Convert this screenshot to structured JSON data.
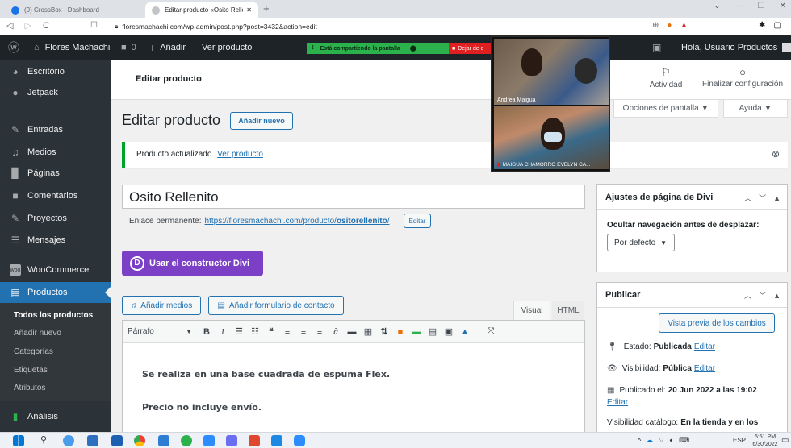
{
  "browser": {
    "tabs": [
      {
        "title": "(9) CrossBox - Dashboard",
        "active": false
      },
      {
        "title": "Editar producto «Osito Rellenito»",
        "active": true
      }
    ],
    "new_tab": "+",
    "url": "floresmachachi.com/wp-admin/post.php?post=3432&action=edit"
  },
  "adminbar": {
    "site": "Flores Machachi",
    "comments_count": "0",
    "add_new": "Añadir",
    "view_product": "Ver producto",
    "greeting": "Hola, Usuario Productos"
  },
  "screen_share": {
    "sharing_label": "Está compartiendo la pantalla",
    "stop_label": "Dejar de c",
    "participant_1": "Andrea Maigua",
    "participant_2": "MAIGUA CHAMORRO EVELYN CA..."
  },
  "sidebar": {
    "items": [
      {
        "label": "Escritorio",
        "icon": "dashboard-icon"
      },
      {
        "label": "Jetpack",
        "icon": "jetpack-icon"
      },
      {
        "label": "Entradas",
        "icon": "pin-icon"
      },
      {
        "label": "Medios",
        "icon": "media-icon"
      },
      {
        "label": "Páginas",
        "icon": "page-icon"
      },
      {
        "label": "Comentarios",
        "icon": "comment-icon"
      },
      {
        "label": "Proyectos",
        "icon": "pin-icon"
      },
      {
        "label": "Mensajes",
        "icon": "messages-icon"
      },
      {
        "label": "WooCommerce",
        "icon": "woo-icon"
      },
      {
        "label": "Productos",
        "icon": "products-icon"
      }
    ],
    "submenu": [
      "Todos los productos",
      "Añadir nuevo",
      "Categorías",
      "Etiquetas",
      "Atributos"
    ],
    "analytics": "Análisis"
  },
  "header": {
    "breadcrumb": "Editar producto",
    "activity": "Actividad",
    "finish_setup": "Finalizar configuración",
    "screen_options": "Opciones de pantalla ▼",
    "help": "Ayuda ▼"
  },
  "page": {
    "title": "Editar producto",
    "add_new": "Añadir nuevo",
    "notice_text": "Producto actualizado.",
    "notice_link": "Ver producto",
    "product_title": "Osito Rellenito",
    "permalink_label": "Enlace permanente:",
    "permalink_base": "https://floresmachachi.com/producto/",
    "permalink_slug": "ositorellenito",
    "permalink_trailing": "/",
    "permalink_edit": "Editar",
    "divi_button": "Usar el constructor Divi",
    "add_media": "Añadir medios",
    "add_form": "Añadir formulario de contacto",
    "tab_visual": "Visual",
    "tab_html": "HTML",
    "format_select": "Párrafo",
    "content_line_1": "Se realiza en una base cuadrada de espuma Flex.",
    "content_line_2": "Precio no incluye envío."
  },
  "divi_box": {
    "title": "Ajustes de página de Divi",
    "hide_nav_label": "Ocultar navegación antes de desplazar:",
    "hide_nav_value": "Por defecto"
  },
  "publish_box": {
    "title": "Publicar",
    "preview": "Vista previa de los cambios",
    "status_label": "Estado:",
    "status_value": "Publicada",
    "status_edit": "Editar",
    "visibility_label": "Visibilidad:",
    "visibility_value": "Pública",
    "visibility_edit": "Editar",
    "published_label": "Publicado el:",
    "published_value": "20 Jun 2022 a las 19:02",
    "published_edit": "Editar",
    "catalog_label": "Visibilidad catálogo:",
    "catalog_value": "En la tienda y en los"
  },
  "taskbar": {
    "lang": "ESP",
    "time": "5:51 PM",
    "date": "6/30/2022"
  },
  "colors": {
    "wp_blue": "#2271b1",
    "divi_purple": "#7b40c6",
    "adminbar": "#1d2327",
    "sidebar": "#2c3338"
  }
}
